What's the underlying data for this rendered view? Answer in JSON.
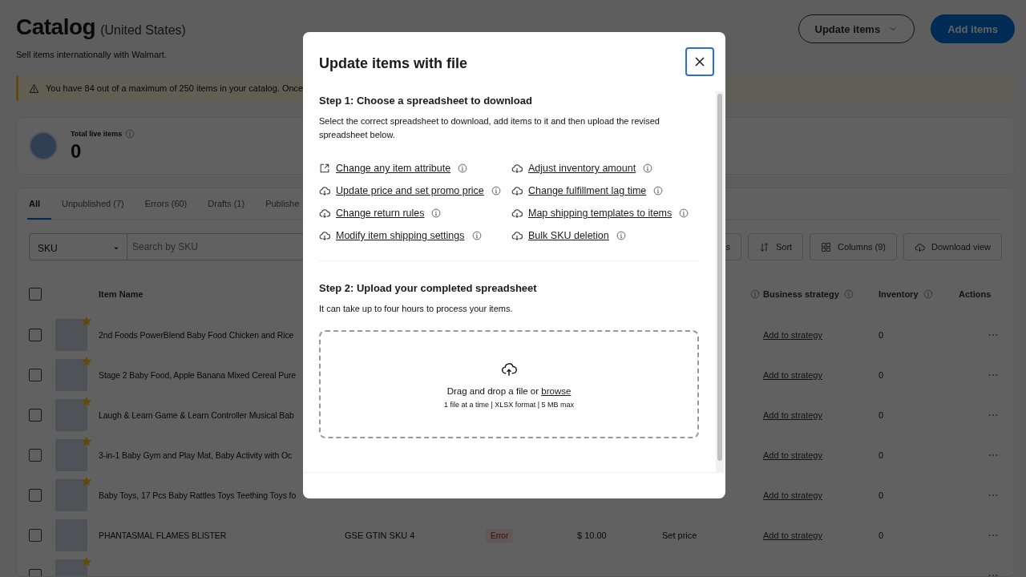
{
  "page": {
    "title": "Catalog",
    "region": "(United States)",
    "subtitle": "Sell items internationally with Walmart.",
    "actions": [
      {
        "label": "Update items",
        "kind": "dropdown"
      },
      {
        "label": "Add items",
        "kind": "primary"
      }
    ]
  },
  "alert": {
    "text": "You have 84 out of a maximum of 250 items in your catalog. Once"
  },
  "summary": {
    "label": "Total live items",
    "value": "0"
  },
  "tabs": [
    {
      "label": "All",
      "selected": true
    },
    {
      "label": "Unpublished (7)",
      "selected": false
    },
    {
      "label": "Errors (60)",
      "selected": false
    },
    {
      "label": "Drafts (1)",
      "selected": false
    },
    {
      "label": "Publishe",
      "selected": false
    }
  ],
  "filters": {
    "field": "SKU",
    "placeholder": "Search by SKU",
    "buttons": [
      {
        "label": "s",
        "kind": "plain"
      },
      {
        "label": "Sort",
        "kind": "sort"
      },
      {
        "label": "Columns (9)",
        "kind": "columns"
      },
      {
        "label": "Download view",
        "kind": "download"
      }
    ]
  },
  "table": {
    "select_all": {
      "checked": false
    },
    "columns": [
      {
        "label": "Item Name",
        "info": false
      },
      {
        "info": true
      },
      {
        "label": "Business strategy",
        "info": true
      },
      {
        "label": "Inventory",
        "info": true
      },
      {
        "label": "Actions",
        "info": false
      }
    ],
    "rows": [
      {
        "checked": false,
        "starred": true,
        "name": "2nd Foods PowerBlend Baby Food Chicken and Rice",
        "strategy": "Add to strategy",
        "inventory": "0"
      },
      {
        "checked": false,
        "starred": true,
        "name": "Stage 2 Baby Food, Apple Banana Mixed Cereal Pure",
        "strategy": "Add to strategy",
        "inventory": "0"
      },
      {
        "checked": false,
        "starred": true,
        "name": "Laugh & Learn Game & Learn Controller Musical Bab",
        "strategy": "Add to strategy",
        "inventory": "0"
      },
      {
        "checked": false,
        "starred": true,
        "name": "3-in-1 Baby Gym and Play Mat, Baby Activity with Oc",
        "strategy": "Add to strategy",
        "inventory": "0"
      },
      {
        "checked": false,
        "starred": true,
        "name": "Baby Toys, 17 Pcs Baby Rattles Toys Teething Toys fo",
        "strategy": "Add to strategy",
        "inventory": "0"
      },
      {
        "checked": false,
        "starred": false,
        "name": "PHANTASMAL FLAMES BLISTER",
        "sku": "GSE GTIN SKU 4",
        "status": "Error",
        "price": "$ 10.00",
        "price_action": "Set price",
        "strategy": "Add to strategy",
        "inventory": "0"
      },
      {
        "checked": false,
        "starred": true
      }
    ]
  },
  "modal": {
    "title": "Update items with file",
    "close": {
      "focused": true
    },
    "step1": {
      "heading": "Step 1: Choose a spreadsheet to download",
      "text": "Select the correct spreadsheet to download, add items to it and then upload the revised spreadsheet below.",
      "links": [
        {
          "label": "Change any item attribute",
          "kind": "external"
        },
        {
          "label": "Adjust inventory amount",
          "kind": "download"
        },
        {
          "label": "Update price and set promo price",
          "kind": "download"
        },
        {
          "label": "Change fulfillment lag time",
          "kind": "download"
        },
        {
          "label": "Change return rules",
          "kind": "download"
        },
        {
          "label": "Map shipping templates to items",
          "kind": "download"
        },
        {
          "label": "Modify item shipping settings",
          "kind": "download"
        },
        {
          "label": "Bulk SKU deletion",
          "kind": "download"
        }
      ]
    },
    "step2": {
      "heading": "Step 2: Upload your completed spreadsheet",
      "text": "It can take up to four hours to process your items.",
      "dropzone": {
        "prompt": "Drag and drop a file or",
        "link": "browse",
        "hint": "1 file at a time | XLSX format | 5 MB max"
      }
    }
  }
}
